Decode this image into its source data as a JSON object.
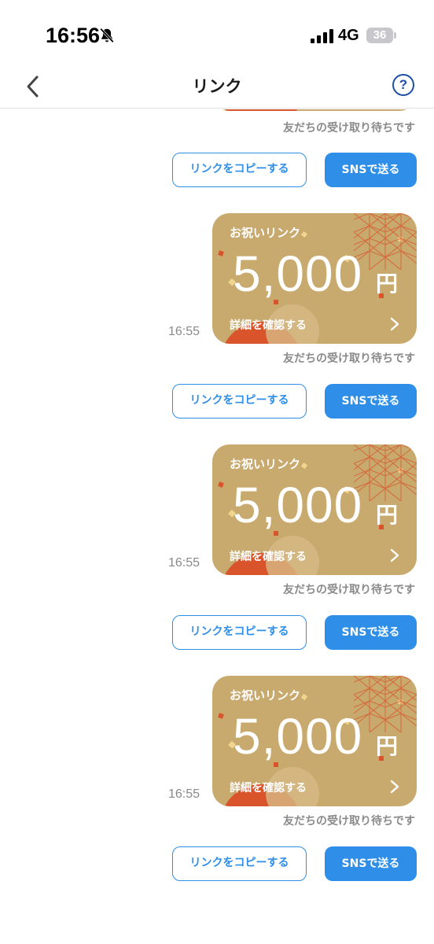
{
  "status_bar": {
    "time": "16:56",
    "network": "4G",
    "battery": "36"
  },
  "nav": {
    "title": "リンク",
    "help_label": "?"
  },
  "colors": {
    "accent": "#2f8fe8",
    "card_gold": "#c8aa6e",
    "card_red": "#d9532b"
  },
  "top_partial": {
    "status_text": "友だちの受け取り待ちです",
    "copy_label": "リンクをコピーする",
    "sns_label": "SNSで送る"
  },
  "gifts": [
    {
      "title": "お祝いリンク",
      "amount": "5,000",
      "unit": "円",
      "detail_label": "詳細を確認する",
      "time": "16:55",
      "status_text": "友だちの受け取り待ちです",
      "copy_label": "リンクをコピーする",
      "sns_label": "SNSで送る"
    },
    {
      "title": "お祝いリンク",
      "amount": "5,000",
      "unit": "円",
      "detail_label": "詳細を確認する",
      "time": "16:55",
      "status_text": "友だちの受け取り待ちです",
      "copy_label": "リンクをコピーする",
      "sns_label": "SNSで送る"
    },
    {
      "title": "お祝いリンク",
      "amount": "5,000",
      "unit": "円",
      "detail_label": "詳細を確認する",
      "time": "16:55",
      "status_text": "友だちの受け取り待ちです",
      "copy_label": "リンクをコピーする",
      "sns_label": "SNSで送る"
    }
  ]
}
